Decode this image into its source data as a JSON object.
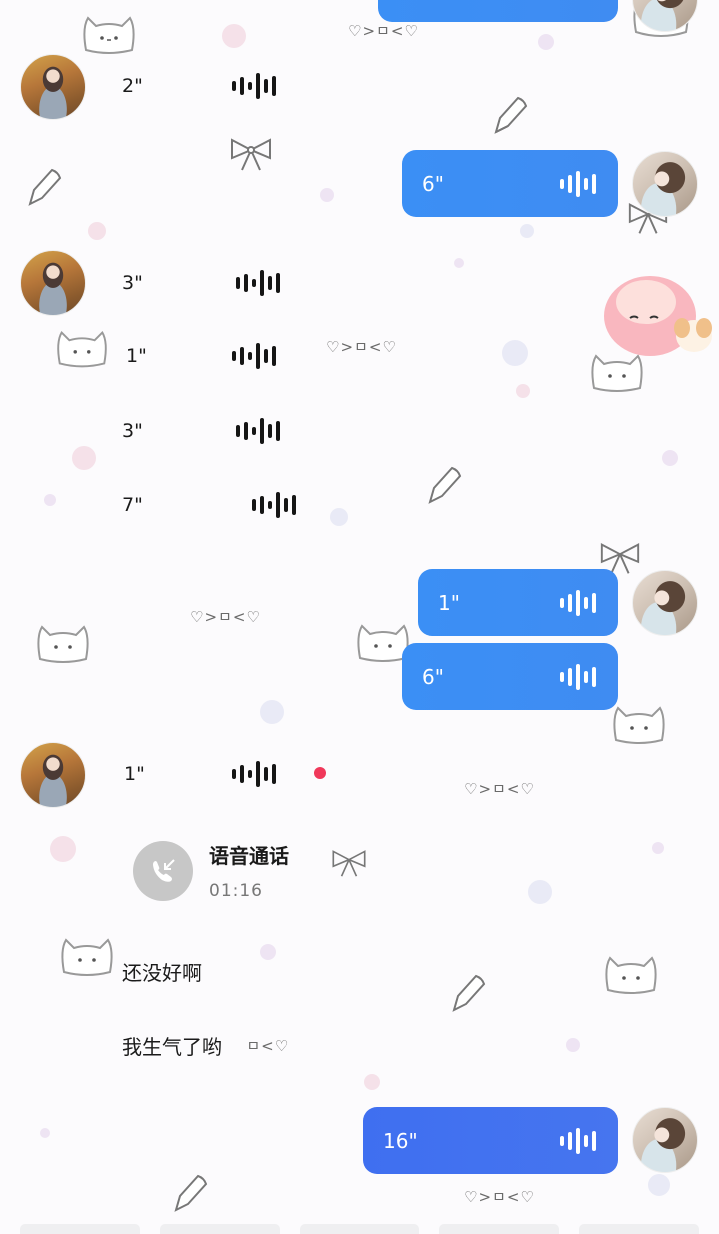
{
  "messages": [
    {
      "side": "left",
      "type": "voice",
      "duration": "2\""
    },
    {
      "side": "right",
      "type": "voice",
      "duration": "6\""
    },
    {
      "side": "left",
      "type": "voice",
      "duration": "3\""
    },
    {
      "side": "left",
      "type": "voice",
      "duration": "1\""
    },
    {
      "side": "left",
      "type": "voice",
      "duration": "3\""
    },
    {
      "side": "left",
      "type": "voice",
      "duration": "7\""
    },
    {
      "side": "right",
      "type": "voice",
      "duration": "1\""
    },
    {
      "side": "right",
      "type": "voice",
      "duration": "6\""
    },
    {
      "side": "left",
      "type": "voice",
      "duration": "1\"",
      "unread": true
    },
    {
      "side": "left",
      "type": "call",
      "title": "语音通话",
      "time": "01:16"
    },
    {
      "side": "left",
      "type": "text",
      "text": "还没好啊"
    },
    {
      "side": "left",
      "type": "text",
      "text": "我生气了哟",
      "suffix": "ㅁ<♡"
    },
    {
      "side": "right",
      "type": "voice",
      "duration": "16\""
    }
  ],
  "decorations": {
    "kaomoji": "♡>ㅁ<♡"
  },
  "colors": {
    "bubble_blue": "#3b8ff5",
    "bubble_indigo": "#3f6ff0",
    "unread_dot": "#f0385a",
    "background": "#fcfbfd"
  }
}
